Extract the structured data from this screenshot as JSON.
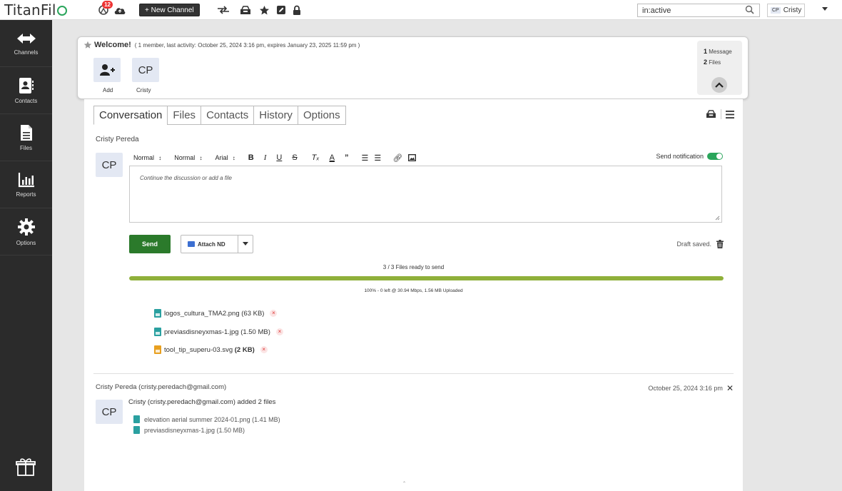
{
  "app": {
    "name_prefix": "TitanFil",
    "notification_count": "12",
    "new_channel_label": "+ New Channel"
  },
  "search": {
    "value": "in:active"
  },
  "user": {
    "initials": "CP",
    "name": "Cristy"
  },
  "sidebar": {
    "items": [
      {
        "label": "Channels",
        "icon": "arrows-icon"
      },
      {
        "label": "Contacts",
        "icon": "contact-card-icon"
      },
      {
        "label": "Files",
        "icon": "file-icon"
      },
      {
        "label": "Reports",
        "icon": "bar-chart-icon"
      },
      {
        "label": "Options",
        "icon": "gear-icon"
      }
    ]
  },
  "channel": {
    "title": "Welcome!",
    "meta": "( 1 member, last activity: October 25, 2024 3:16 pm, expires January 23, 2025 11:59 pm )",
    "add_label": "Add",
    "member_initials": "CP",
    "member_name": "Cristy",
    "stats": {
      "messages_count": "1",
      "messages_label": "Message",
      "files_count": "2",
      "files_label": "Files"
    }
  },
  "tabs": [
    "Conversation",
    "Files",
    "Contacts",
    "History",
    "Options"
  ],
  "composer": {
    "author": "Cristy Pereda",
    "avatar_initials": "CP",
    "format_normal_1": "Normal",
    "format_normal_2": "Normal",
    "font": "Arial",
    "send_notification_label": "Send notification",
    "send_notification_on": true,
    "placeholder": "Continue the discussion or add a file",
    "send_label": "Send",
    "attach_label": "Attach ND",
    "draft_status": "Draft saved."
  },
  "upload": {
    "ready_text": "3 / 3 Files ready to send",
    "progress_percent": 100,
    "status_text": "100% - 0 left @ 30.94 Mbps, 1.56 MB Uploaded",
    "files": [
      {
        "name": "logos_cultura_TMA2.png",
        "size": "(63 KB)",
        "color": "#2aa0a0"
      },
      {
        "name": "previasdisneyxmas-1.jpg",
        "size": "(1.50 MB)",
        "color": "#2aa0a0"
      },
      {
        "name": "tool_tip_superu-03.svg",
        "size": "(2 KB)",
        "color": "#e8a020"
      }
    ]
  },
  "log": {
    "author": "Cristy Pereda (cristy.peredach@gmail.com)",
    "date": "October 25, 2024 3:16 pm",
    "avatar_initials": "CP",
    "summary": "Cristy (cristy.peredach@gmail.com) added 2 files",
    "files": [
      "elevation aerial summer 2024-01.png (1.41 MB)",
      "previasdisneyxmas-1.jpg (1.50 MB)"
    ]
  },
  "colors": {
    "accent_green": "#2b7a2b",
    "toggle_green": "#2aa55b",
    "progress_fill": "#8fb03a",
    "sidebar_bg": "#2b2b2b"
  }
}
